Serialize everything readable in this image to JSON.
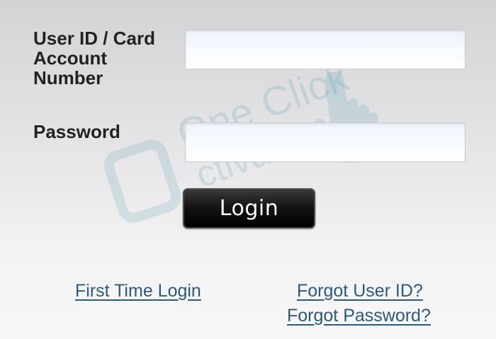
{
  "form": {
    "userid_label": "User ID / Card Account Number",
    "userid_value": "",
    "password_label": "Password",
    "password_value": "",
    "login_label": "Login"
  },
  "links": {
    "first_time_login": "First Time Login",
    "forgot_user_id": "Forgot User ID?",
    "forgot_password": "Forgot Password?"
  },
  "watermark": {
    "line1": "One Click",
    "line2": "ctivate",
    "icon": "hand-pointer-icon",
    "color": "#7fb8c4"
  },
  "colors": {
    "link": "#2c5a7a",
    "label": "#222222",
    "button": "#000000"
  }
}
